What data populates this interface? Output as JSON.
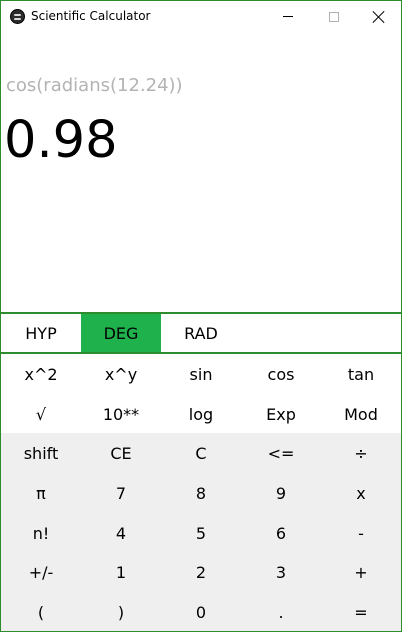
{
  "window": {
    "title": "Scientific Calculator",
    "icon": "calculator-app-icon",
    "controls": [
      "minimize-icon",
      "maximize-icon",
      "close-icon"
    ]
  },
  "display": {
    "expression": "cos(radians(12.24))",
    "result": "0.98"
  },
  "modes": {
    "active": "DEG",
    "accent_color": "#1fb14b",
    "border_color": "#2e8b2e",
    "items": [
      "HYP",
      "DEG",
      "RAD"
    ]
  },
  "keypad": {
    "rows": [
      [
        "x^2",
        "x^y",
        "sin",
        "cos",
        "tan"
      ],
      [
        "√",
        "10**",
        "log",
        "Exp",
        "Mod"
      ],
      [
        "shift",
        "CE",
        "C",
        "<=",
        "÷"
      ],
      [
        "π",
        "7",
        "8",
        "9",
        "x"
      ],
      [
        "n!",
        "4",
        "5",
        "6",
        "-"
      ],
      [
        "+/-",
        "1",
        "2",
        "3",
        "+"
      ],
      [
        "(",
        ")",
        "0",
        ".",
        "="
      ]
    ],
    "numeric_area_color": "#efefef"
  }
}
